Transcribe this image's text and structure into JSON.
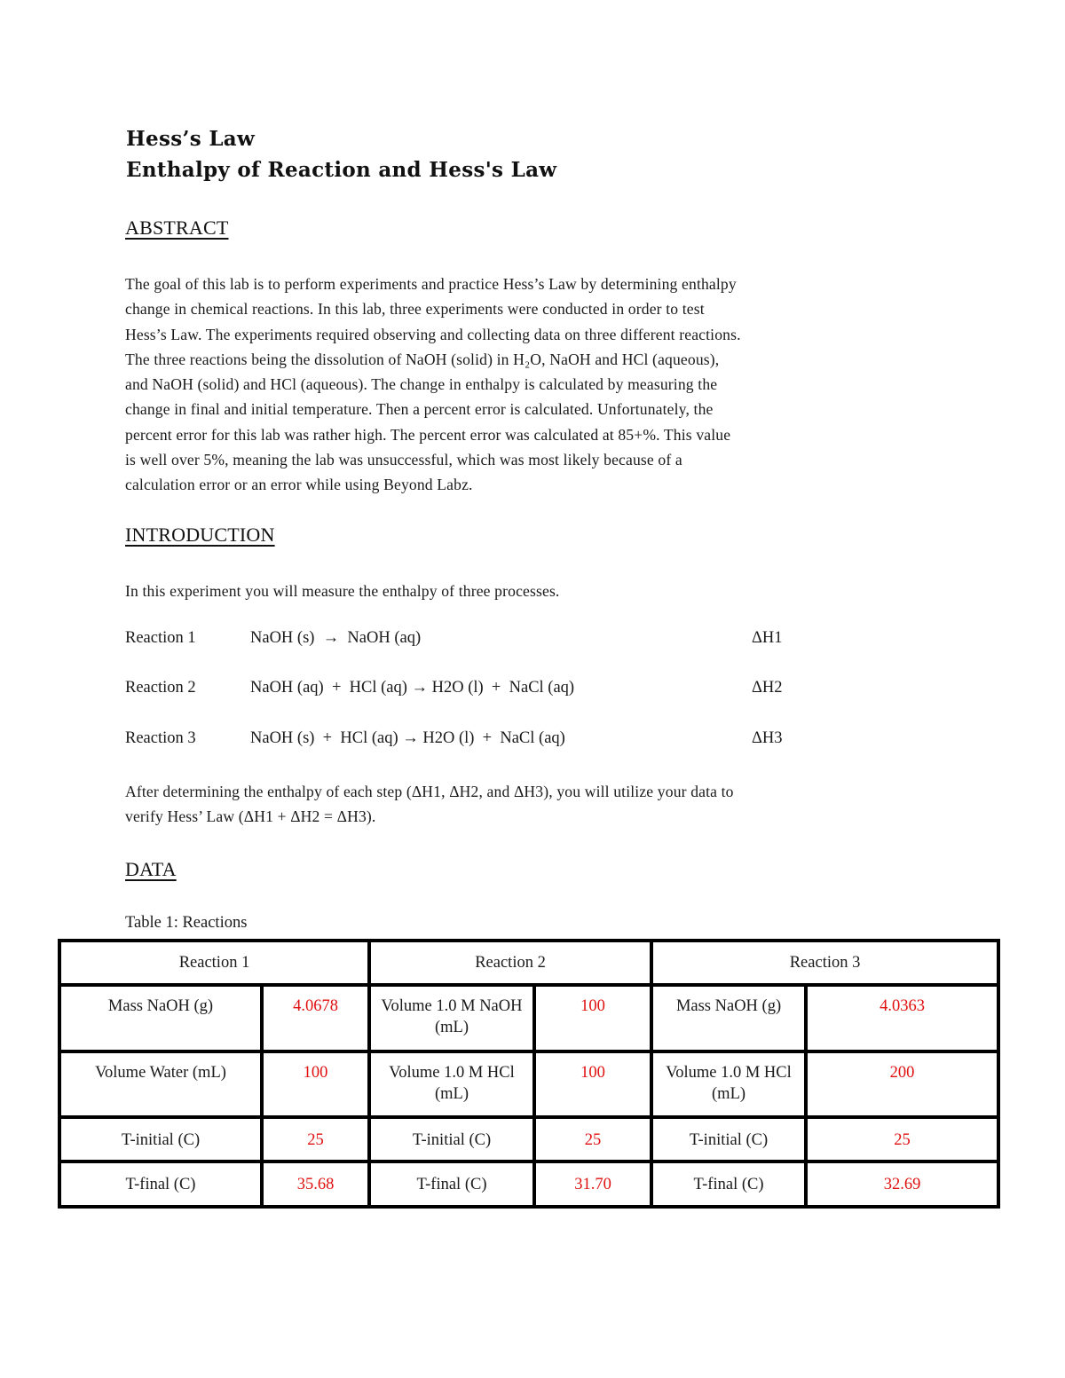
{
  "document": {
    "title": "Hess’s Law",
    "subtitle": "Enthalpy of Reaction and Hess's Law",
    "abstract": {
      "heading": "ABSTRACT",
      "lines": [
        "The goal of this lab is to perform experiments and practice Hess’s Law by determining enthalpy",
        "change in chemical reactions. In this lab, three experiments were conducted in order to test",
        "Hess’s Law. The experiments required observing and collecting data on three different reactions.",
        "The three reactions being the dissolution of NaOH (solid) in H₂O, NaOH and HCl (aqueous),",
        "and NaOH (solid) and HCl (aqueous). The change in enthalpy is calculated by measuring the",
        "change in final and initial temperature. Then a percent error is calculated. Unfortunately, the",
        "percent error for this lab was rather high. The percent error was calculated at 85+%. This value",
        "is well over 5%, meaning the lab was unsuccessful, which was most likely because of a",
        "calculation error or an error while using Beyond Labz."
      ]
    },
    "introduction": {
      "heading": "INTRODUCTION",
      "lead": "In this experiment you will measure the enthalpy of three processes.",
      "reactions": [
        {
          "label": "Reaction 1",
          "equation": "NaOH (s)  →  NaOH (aq)",
          "delta": "ΔH1"
        },
        {
          "label": "Reaction 2",
          "equation": "NaOH (aq)  +  HCl (aq) → H2O (l)  +  NaCl (aq)",
          "delta": "ΔH2"
        },
        {
          "label": "Reaction 3",
          "equation": "NaOH (s)  +  HCl (aq) → H2O (l)  +  NaCl (aq)",
          "delta": "ΔH3"
        }
      ],
      "closing_lines": [
        "After determining the enthalpy of each step (ΔH1, ΔH2, and ΔH3), you will utilize your data to",
        "verify Hess’ Law (ΔH1 + ΔH2 = ΔH3)."
      ]
    },
    "data": {
      "heading": "DATA",
      "table_caption": "Table 1: Reactions",
      "value_color": "#e01010",
      "table": {
        "headers": [
          "Reaction 1",
          "Reaction 2",
          "Reaction 3"
        ],
        "rows": [
          [
            {
              "label": "Mass NaOH (g)",
              "value": "4.0678"
            },
            {
              "label": "Volume 1.0 M NaOH (mL)",
              "value": "100"
            },
            {
              "label": "Mass NaOH (g)",
              "value": "4.0363"
            }
          ],
          [
            {
              "label": "Volume Water (mL)",
              "value": "100"
            },
            {
              "label": "Volume 1.0 M HCl (mL)",
              "value": "100"
            },
            {
              "label": "Volume 1.0 M HCl (mL)",
              "value": "200"
            }
          ],
          [
            {
              "label": "T-initial (C)",
              "value": "25"
            },
            {
              "label": "T-initial (C)",
              "value": "25"
            },
            {
              "label": "T-initial (C)",
              "value": "25"
            }
          ],
          [
            {
              "label": "T-final (C)",
              "value": "35.68"
            },
            {
              "label": "T-final (C)",
              "value": "31.70"
            },
            {
              "label": "T-final (C)",
              "value": "32.69"
            }
          ]
        ]
      }
    }
  }
}
